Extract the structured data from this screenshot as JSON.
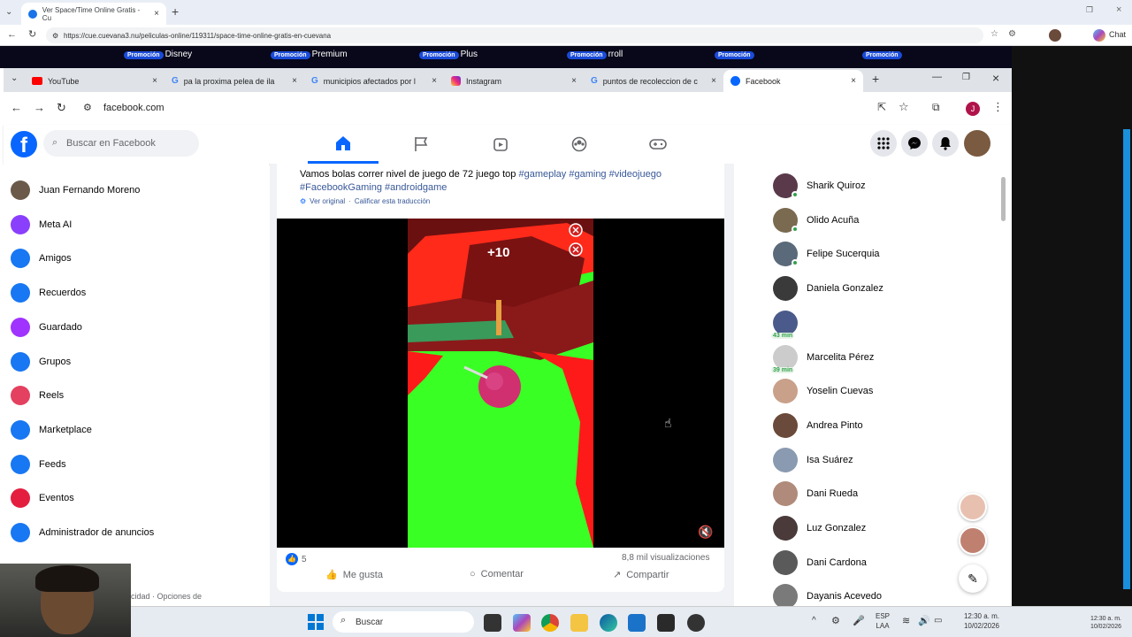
{
  "outer_browser": {
    "tab_title": "Ver Space/Time Online Gratis - Cu",
    "url": "https://cue.cuevana3.nu/peliculas-online/119311/space-time-online-gratis-en-cuevana",
    "chat_label": "Chat"
  },
  "promo_bar": {
    "badge": "Promoción",
    "items": [
      "Disney",
      "Premium",
      "Plus",
      "rroll",
      "",
      ""
    ]
  },
  "inner_browser": {
    "tabs": [
      {
        "label": "YouTube",
        "icon": "youtube-icon"
      },
      {
        "label": "pa la proxima pelea de ila",
        "icon": "google-icon"
      },
      {
        "label": "municipios afectados por l",
        "icon": "google-icon"
      },
      {
        "label": "Instagram",
        "icon": "instagram-icon"
      },
      {
        "label": "puntos de recoleccion de c",
        "icon": "google-icon"
      },
      {
        "label": "Facebook",
        "icon": "facebook-icon"
      }
    ],
    "url": "facebook.com",
    "profile_initial": "J"
  },
  "facebook": {
    "logo": "f",
    "search_placeholder": "Buscar en Facebook",
    "left_nav": [
      {
        "label": "Juan Fernando Moreno",
        "icon": "avatar-icon",
        "color": "#6b5a4a"
      },
      {
        "label": "Meta AI",
        "icon": "meta-ai-icon",
        "color": "#8a3ffc"
      },
      {
        "label": "Amigos",
        "icon": "friends-icon",
        "color": "#1877f2"
      },
      {
        "label": "Recuerdos",
        "icon": "memories-icon",
        "color": "#1877f2"
      },
      {
        "label": "Guardado",
        "icon": "saved-icon",
        "color": "#a033ff"
      },
      {
        "label": "Grupos",
        "icon": "groups-icon",
        "color": "#1877f2"
      },
      {
        "label": "Reels",
        "icon": "reels-icon",
        "color": "#e4405f"
      },
      {
        "label": "Marketplace",
        "icon": "marketplace-icon",
        "color": "#1877f2"
      },
      {
        "label": "Feeds",
        "icon": "feeds-icon",
        "color": "#1877f2"
      },
      {
        "label": "Eventos",
        "icon": "events-icon",
        "color": "#e41e3f"
      },
      {
        "label": "Administrador de anuncios",
        "icon": "ads-manager-icon",
        "color": "#1877f2"
      }
    ],
    "footer_text": "cidad · Opciones de",
    "post": {
      "text": "Vamos bolas correr nivel de juego de 72 juego top",
      "hashtags_line1": [
        "#gameplay",
        "#gaming",
        "#videojuego"
      ],
      "hashtags_line2": [
        "#FacebookGaming",
        "#androidgame"
      ],
      "see_original": "Ver original",
      "rate_translation": "Calificar esta traducción",
      "game_score": "+10",
      "likes": "5",
      "views": "8,8 mil visualizaciones",
      "actions": {
        "like": "Me gusta",
        "comment": "Comentar",
        "share": "Compartir"
      }
    },
    "contacts": [
      {
        "name": "Sharik Quiroz",
        "online": true,
        "badge": "",
        "color": "#5a3a4a"
      },
      {
        "name": "Olido Acuña",
        "online": true,
        "badge": "",
        "color": "#7a6a50"
      },
      {
        "name": "Felipe Sucerquia",
        "online": true,
        "badge": "",
        "color": "#5a6a7a"
      },
      {
        "name": "Daniela Gonzalez",
        "online": false,
        "badge": "",
        "color": "#3a3a3a"
      },
      {
        "name": "",
        "online": false,
        "badge": "43 min",
        "color": "#4a5a8a"
      },
      {
        "name": "Marcelita Pérez",
        "online": false,
        "badge": "39 min",
        "color": "#cccccc"
      },
      {
        "name": "Yoselin Cuevas",
        "online": false,
        "badge": "",
        "color": "#c9a08a"
      },
      {
        "name": "Andrea Pinto",
        "online": false,
        "badge": "",
        "color": "#6a4a3a"
      },
      {
        "name": "Isa Suárez",
        "online": false,
        "badge": "",
        "color": "#8a9ab0"
      },
      {
        "name": "Dani Rueda",
        "online": false,
        "badge": "",
        "color": "#b08a7a"
      },
      {
        "name": "Luz Gonzalez",
        "online": false,
        "badge": "",
        "color": "#4a3a3a"
      },
      {
        "name": "Dani Cardona",
        "online": false,
        "badge": "",
        "color": "#5a5a5a"
      },
      {
        "name": "Dayanis Acevedo",
        "online": false,
        "badge": "",
        "color": "#7a7a7a"
      }
    ]
  },
  "taskbar": {
    "search_label": "Buscar",
    "language": "ESP",
    "region": "LAA",
    "time": "12:30 a. m.",
    "date": "10/02/2026",
    "mini_time": "12:30 a. m.",
    "mini_date": "10/02/2026"
  }
}
